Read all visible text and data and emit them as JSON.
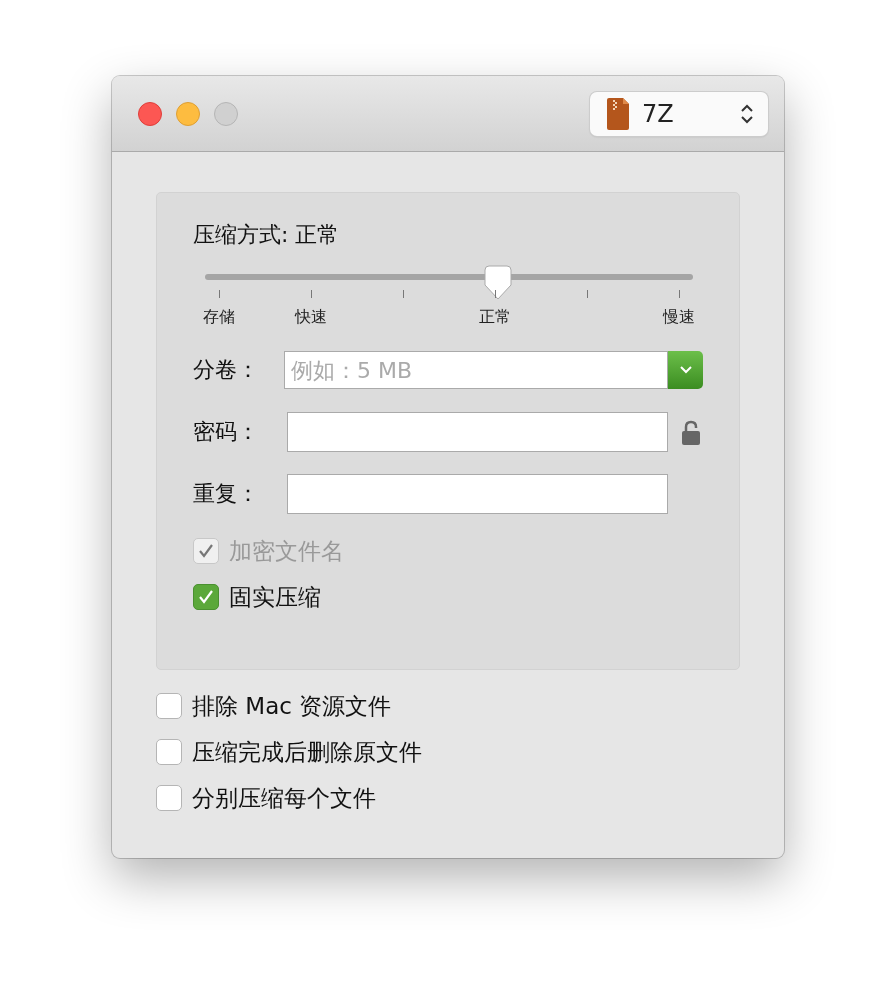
{
  "window": {
    "buttons": [
      {
        "kind": "close"
      },
      {
        "kind": "minimize"
      },
      {
        "kind": "zoom",
        "disabled": true
      }
    ],
    "format_popup": {
      "value": "7Z"
    }
  },
  "compression": {
    "heading": "压缩方式: 正常",
    "slider": {
      "level": 0.6,
      "ticks": [
        {
          "kind": "labeled",
          "label": "存储"
        },
        {
          "kind": "labeled",
          "label": "快速"
        },
        {
          "kind": "plain"
        },
        {
          "kind": "labeled",
          "label": "正常"
        },
        {
          "kind": "plain"
        },
        {
          "kind": "labeled",
          "label": "慢速"
        }
      ]
    }
  },
  "fields": [
    {
      "kind": "combo",
      "label": "分卷：",
      "placeholder": "例如：5 MB"
    },
    {
      "kind": "password",
      "label": "密码：",
      "locked": false
    },
    {
      "kind": "text",
      "label": "重复："
    }
  ],
  "panel_options": [
    {
      "label": "加密文件名",
      "checked": true,
      "disabled": true
    },
    {
      "label": "固实压缩",
      "checked": true,
      "disabled": false
    }
  ],
  "options": [
    {
      "label": "排除 Mac 资源文件",
      "checked": false
    },
    {
      "label": "压缩完成后删除原文件",
      "checked": false
    },
    {
      "label": "分别压缩每个文件",
      "checked": false
    }
  ]
}
